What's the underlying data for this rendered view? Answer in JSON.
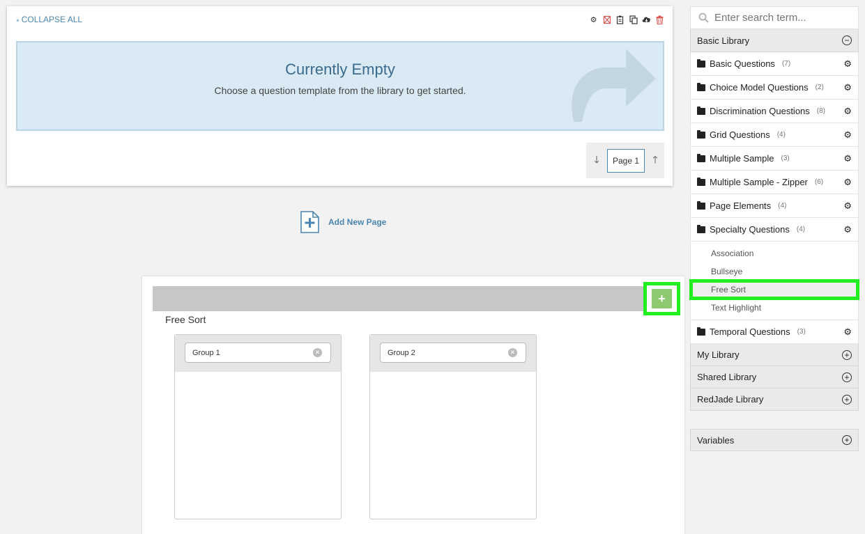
{
  "page_card": {
    "collapse_all": "COLLAPSE ALL",
    "toolbar_icons": [
      "gear-icon",
      "delete-formatting-icon",
      "clipboard-icon",
      "copy-icon",
      "cloud-download-icon",
      "trash-icon"
    ],
    "empty_title": "Currently Empty",
    "empty_subtitle": "Choose a question template from the library to get started.",
    "page_label": "Page 1"
  },
  "add_page": {
    "label": "Add New Page"
  },
  "sidebar": {
    "search_placeholder": "Enter search term...",
    "basic_library": {
      "title": "Basic Library",
      "folders": [
        {
          "name": "Basic Questions",
          "count": "(7)"
        },
        {
          "name": "Choice Model Questions",
          "count": "(2)"
        },
        {
          "name": "Discrimination Questions",
          "count": "(8)"
        },
        {
          "name": "Grid Questions",
          "count": "(4)"
        },
        {
          "name": "Multiple Sample",
          "count": "(3)"
        },
        {
          "name": "Multiple Sample - Zipper",
          "count": "(6)"
        },
        {
          "name": "Page Elements",
          "count": "(4)"
        },
        {
          "name": "Specialty Questions",
          "count": "(4)"
        }
      ],
      "specialty_items": [
        "Association",
        "Bullseye",
        "Free Sort",
        "Text Highlight"
      ],
      "last_folder": {
        "name": "Temporal Questions",
        "count": "(3)"
      }
    },
    "libraries": [
      "My Library",
      "Shared Library",
      "RedJade Library"
    ],
    "variables": "Variables"
  },
  "preview": {
    "title": "Free Sort",
    "groups": [
      "Group 1",
      "Group 2"
    ],
    "add_symbol": "+"
  },
  "colors": {
    "accent": "#4a86b0",
    "highlight": "#22ee22",
    "add_button": "#8cc96f",
    "empty_bg": "#d9eaf4"
  }
}
